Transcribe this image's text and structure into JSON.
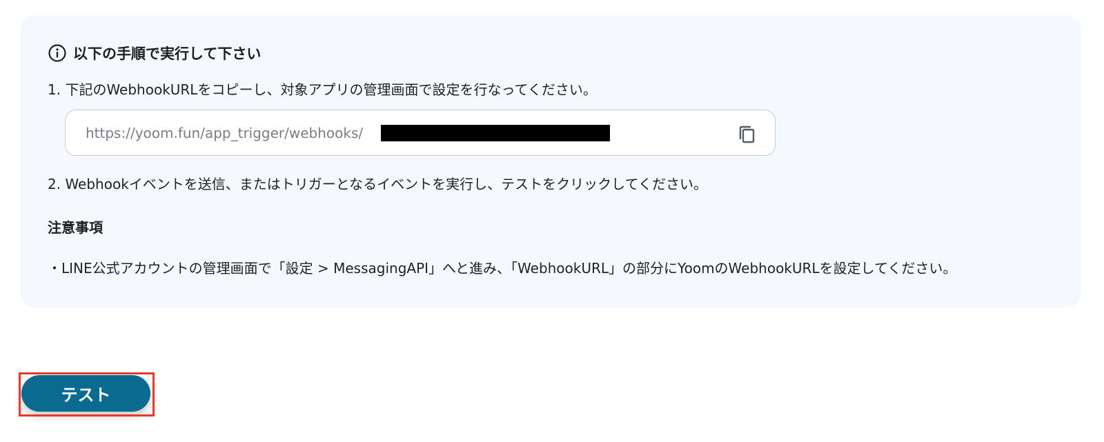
{
  "instructions": {
    "heading": "以下の手順で実行して下さい",
    "step1": "1. 下記のWebhookURLをコピーし、対象アプリの管理画面で設定を行なってください。",
    "webhook_url": "https://yoom.fun/app_trigger/webhooks/",
    "step2": "2. Webhookイベントを送信、またはトリガーとなるイベントを実行し、テストをクリックしてください。"
  },
  "notes": {
    "title": "注意事項",
    "text": "・LINE公式アカウントの管理画面で「設定 > MessagingAPI」へと進み、「WebhookURL」の部分にYoomのWebhookURLを設定してください。"
  },
  "actions": {
    "test_label": "テスト"
  },
  "icons": {
    "info": "info-icon",
    "copy": "copy-icon"
  },
  "colors": {
    "panel_bg": "#f5f8fc",
    "test_button": "#0b6a8f",
    "highlight": "#e8382a"
  }
}
